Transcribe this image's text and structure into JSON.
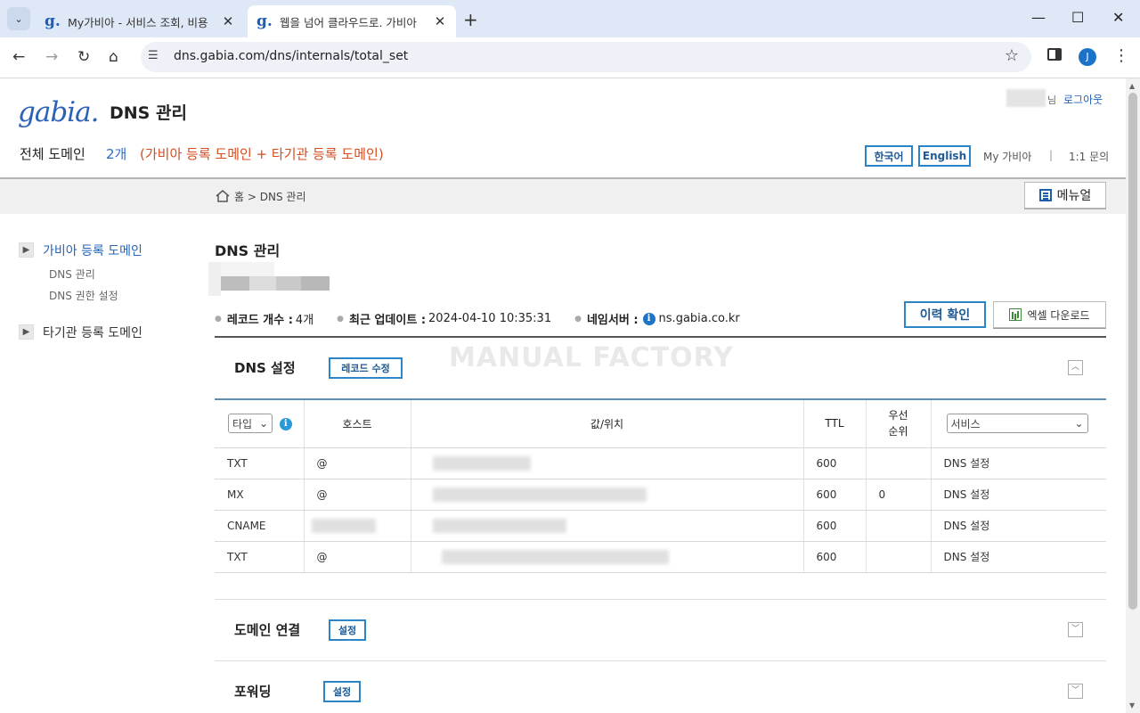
{
  "browser": {
    "tabs": [
      {
        "favicon": "g.",
        "title": "My가비아 - 서비스 조회, 비용"
      },
      {
        "favicon": "g.",
        "title": "웹을 넘어 클라우드로. 가비아"
      }
    ],
    "url": "dns.gabia.com/dns/internals/total_set",
    "profile_initial": "J"
  },
  "header": {
    "logo": "gabia.",
    "title": "DNS 관리",
    "user_suffix": "님",
    "logout": "로그아웃",
    "total_domain_label": "전체 도메인",
    "total_domain_count": "2개",
    "total_domain_desc": "(가비아 등록 도메인 + 타기관 등록 도메인)",
    "lang_ko": "한국어",
    "lang_en": "English",
    "my_gabia": "My 가비아",
    "divider": "|",
    "inquiry": "1:1 문의"
  },
  "breadcrumb": {
    "home": "홈",
    "sep": ">",
    "current": "DNS 관리",
    "manual_btn": "메뉴얼"
  },
  "sidebar": {
    "groups": [
      {
        "label": "가비아 등록 도메인",
        "items": [
          "DNS 관리",
          "DNS 권한 설정"
        ]
      },
      {
        "label": "타기관 등록 도메인",
        "items": []
      }
    ]
  },
  "main": {
    "title": "DNS 관리",
    "record_count_label": "레코드 개수 :",
    "record_count": "4개",
    "updated_label": "최근 업데이트 :",
    "updated_value": "2024-04-10 10:35:31",
    "ns_label": "네임서버 :",
    "ns_value": "ns.gabia.co.kr",
    "history_btn": "이력 확인",
    "excel_btn": "엑셀 다운로드",
    "watermark": "MANUAL FACTORY"
  },
  "dns_section": {
    "title": "DNS 설정",
    "edit_btn": "레코드 수정",
    "columns": {
      "type": "타입",
      "host": "호스트",
      "value": "값/위치",
      "ttl": "TTL",
      "priority_1": "우선",
      "priority_2": "순위",
      "service": "서비스"
    },
    "rows": [
      {
        "type": "TXT",
        "host": "@",
        "ttl": "600",
        "priority": "",
        "service": "DNS 설정"
      },
      {
        "type": "MX",
        "host": "@",
        "ttl": "600",
        "priority": "0",
        "service": "DNS 설정"
      },
      {
        "type": "CNAME",
        "host": "",
        "ttl": "600",
        "priority": "",
        "service": "DNS 설정"
      },
      {
        "type": "TXT",
        "host": "@",
        "ttl": "600",
        "priority": "",
        "service": "DNS 설정"
      }
    ]
  },
  "domain_connect": {
    "title": "도메인 연결",
    "btn": "설정"
  },
  "forwarding": {
    "title": "포워딩",
    "btn": "설정"
  }
}
